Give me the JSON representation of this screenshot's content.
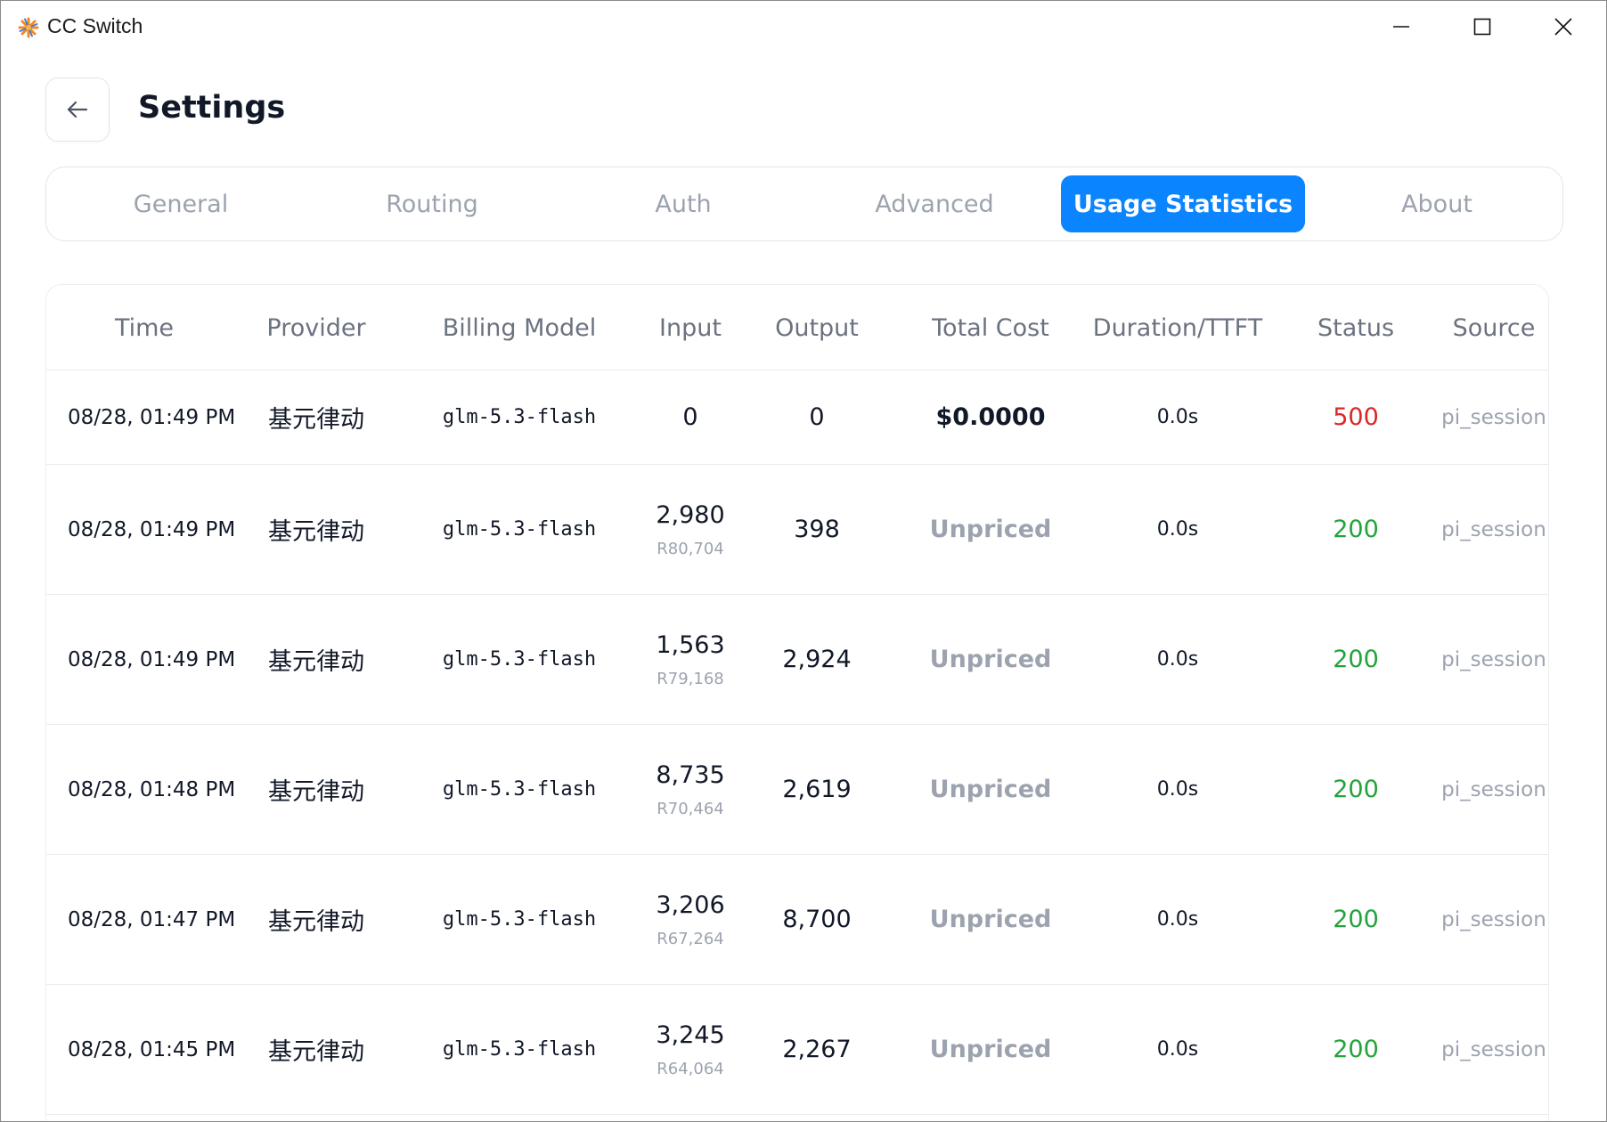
{
  "window": {
    "title": "CC Switch"
  },
  "header": {
    "title": "Settings"
  },
  "tabs": [
    {
      "label": "General",
      "active": false
    },
    {
      "label": "Routing",
      "active": false
    },
    {
      "label": "Auth",
      "active": false
    },
    {
      "label": "Advanced",
      "active": false
    },
    {
      "label": "Usage Statistics",
      "active": true
    },
    {
      "label": "About",
      "active": false
    }
  ],
  "colors": {
    "accent": "#0a84ff",
    "status_ok": "#22a33a",
    "status_error": "#dc2626"
  },
  "table": {
    "columns": [
      "Time",
      "Provider",
      "Billing Model",
      "Input",
      "Output",
      "Total Cost",
      "Duration/TTFT",
      "Status",
      "Source"
    ],
    "rows": [
      {
        "time": "08/28, 01:49 PM",
        "provider": "基元律动",
        "model": "glm-5.3-flash",
        "input": "0",
        "input_sub": "",
        "output": "0",
        "cost": "$0.0000",
        "priced": true,
        "duration": "0.0s",
        "status": "500",
        "source": "pi_session"
      },
      {
        "time": "08/28, 01:49 PM",
        "provider": "基元律动",
        "model": "glm-5.3-flash",
        "input": "2,980",
        "input_sub": "R80,704",
        "output": "398",
        "cost": "Unpriced",
        "priced": false,
        "duration": "0.0s",
        "status": "200",
        "source": "pi_session"
      },
      {
        "time": "08/28, 01:49 PM",
        "provider": "基元律动",
        "model": "glm-5.3-flash",
        "input": "1,563",
        "input_sub": "R79,168",
        "output": "2,924",
        "cost": "Unpriced",
        "priced": false,
        "duration": "0.0s",
        "status": "200",
        "source": "pi_session"
      },
      {
        "time": "08/28, 01:48 PM",
        "provider": "基元律动",
        "model": "glm-5.3-flash",
        "input": "8,735",
        "input_sub": "R70,464",
        "output": "2,619",
        "cost": "Unpriced",
        "priced": false,
        "duration": "0.0s",
        "status": "200",
        "source": "pi_session"
      },
      {
        "time": "08/28, 01:47 PM",
        "provider": "基元律动",
        "model": "glm-5.3-flash",
        "input": "3,206",
        "input_sub": "R67,264",
        "output": "8,700",
        "cost": "Unpriced",
        "priced": false,
        "duration": "0.0s",
        "status": "200",
        "source": "pi_session"
      },
      {
        "time": "08/28, 01:45 PM",
        "provider": "基元律动",
        "model": "glm-5.3-flash",
        "input": "3,245",
        "input_sub": "R64,064",
        "output": "2,267",
        "cost": "Unpriced",
        "priced": false,
        "duration": "0.0s",
        "status": "200",
        "source": "pi_session"
      }
    ]
  }
}
